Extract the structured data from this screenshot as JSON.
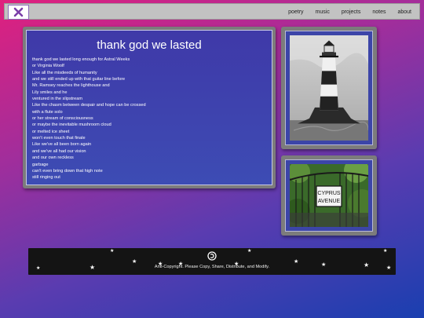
{
  "header": {
    "logo_icon": "close-x-icon",
    "nav": [
      "poetry",
      "music",
      "projects",
      "notes",
      "about"
    ]
  },
  "poem": {
    "title": "thank god we lasted",
    "lines": [
      "thank god we lasted long enough for Astral Weeks",
      "or Virginia Woolf",
      "Like all the misdeeds of humanity",
      "and we still ended up with that guitar line before",
      "Mr. Ramsey reaches the lighthouse and",
      "Lily smiles and he",
      "ventured in the slipstream",
      "Like the chasm between despair and hope can be crossed",
      "with a flute solo",
      "or her stream of consciousness",
      "or maybe the inevitable mushroom cloud",
      "or melted ice sheet",
      "won't even touch that finale",
      "Like we've all been born again",
      "and we've all had our vision",
      "and our own reckless",
      "garbage",
      "can't even bring down that high note",
      "still ringing out"
    ]
  },
  "images": {
    "photo1": "lighthouse photo",
    "photo2": "street sign photo",
    "sign_line1": "CYPRUS",
    "sign_line2": "AVENUE"
  },
  "footer": {
    "icon": "copyleft-icon",
    "text": "Anti-Copyright. Please Copy, Share, Distribute, and Modify."
  },
  "colors": {
    "accent": "#3f39a8",
    "logo": "#7a3fa8"
  }
}
